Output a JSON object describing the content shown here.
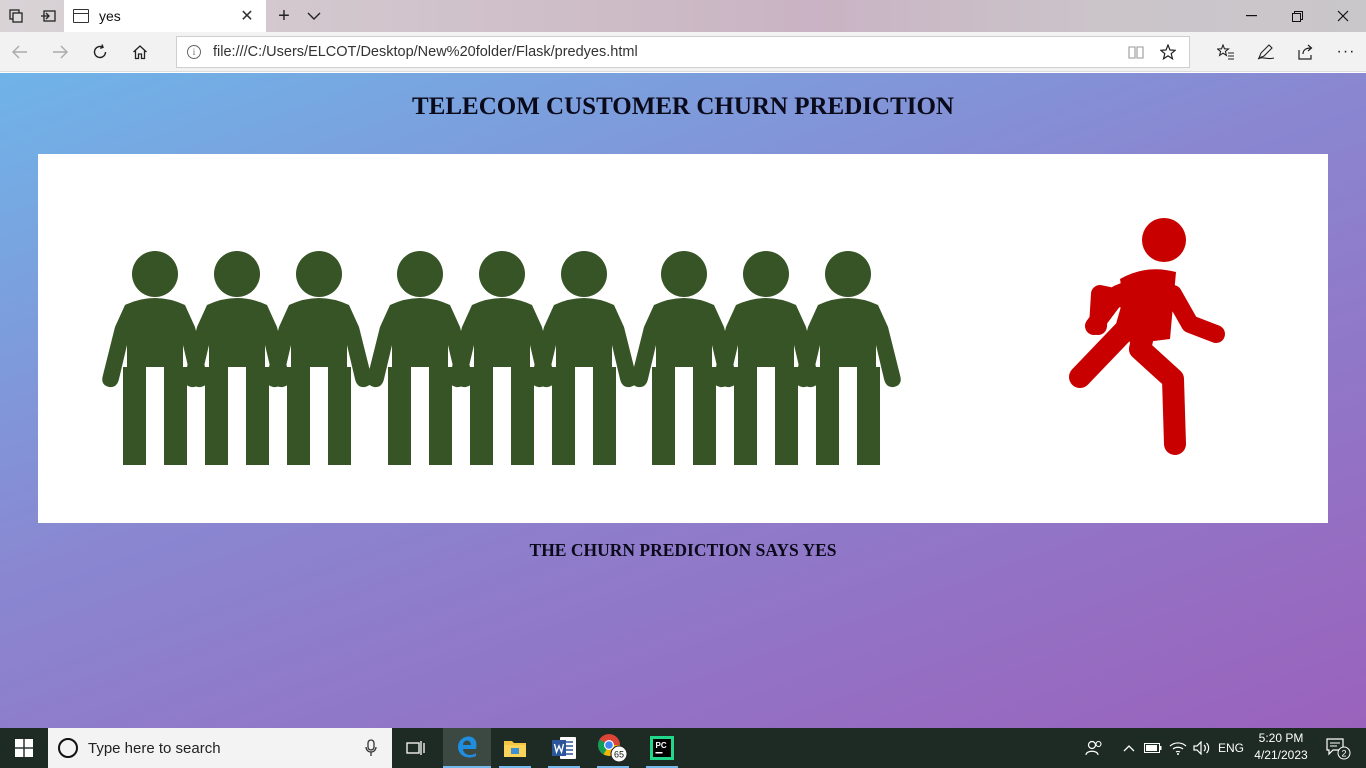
{
  "browser": {
    "tab": {
      "title": "yes"
    },
    "address": {
      "url": "file:///C:/Users/ELCOT/Desktop/New%20folder/Flask/predyes.html"
    }
  },
  "page": {
    "heading": "TELECOM CUSTOMER CHURN PREDICTION",
    "result_text": "THE CHURN PREDICTION SAYS YES",
    "illustration": {
      "group_color": "#375426",
      "leaving_color": "#c80000",
      "group_count": 9
    }
  },
  "taskbar": {
    "search_placeholder": "Type here to search",
    "chrome_badge": "65",
    "language": "ENG",
    "time": "5:20 PM",
    "date": "4/21/2023",
    "notifications": "2"
  }
}
